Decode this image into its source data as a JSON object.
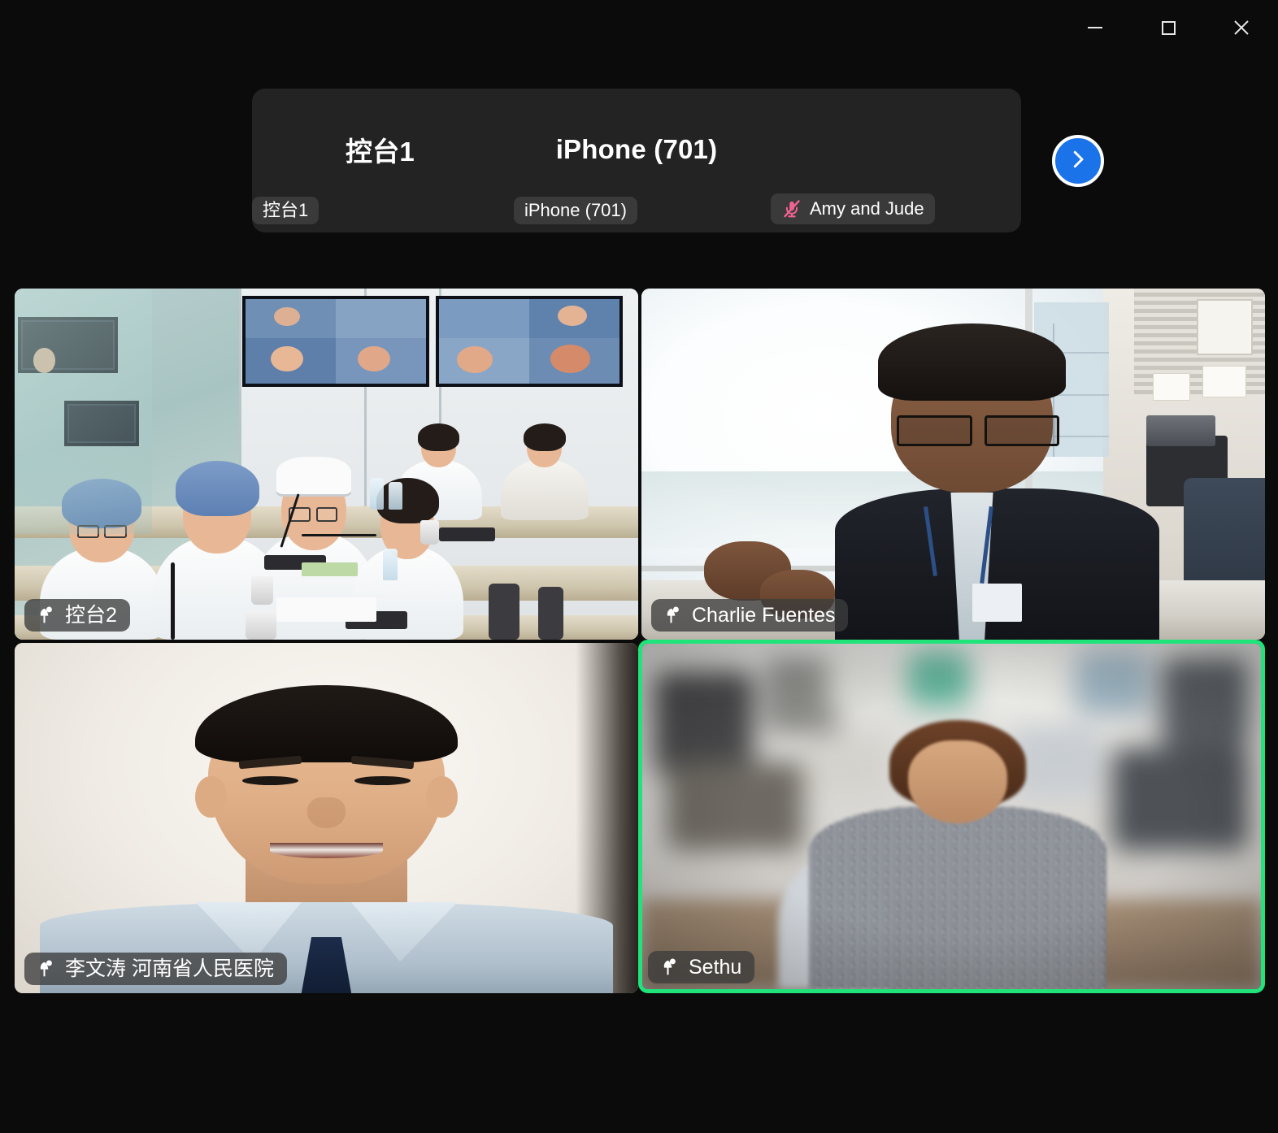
{
  "window": {
    "controls": [
      {
        "name": "minimize",
        "glyph": "minimize-icon"
      },
      {
        "name": "maximize",
        "glyph": "maximize-icon"
      },
      {
        "name": "close",
        "glyph": "close-icon"
      }
    ]
  },
  "filmstrip": {
    "tiles": [
      {
        "display_name": "控台1",
        "badge_label": "控台1",
        "muted": false,
        "video_on": false
      },
      {
        "display_name": "iPhone (701)",
        "badge_label": "iPhone (701)",
        "muted": false,
        "video_on": false
      },
      {
        "display_name": "",
        "badge_label": "Amy and Jude",
        "muted": true,
        "video_on": false
      }
    ],
    "next_button_label": "next-page-arrow"
  },
  "grid": {
    "tiles": [
      {
        "position": "top-left",
        "name_label": "控台2",
        "pinned": true,
        "active_speaker": false,
        "scene": "hospital conference room, staff in blue surgical caps and white coats at long tables, wall monitors showing remote video feeds"
      },
      {
        "position": "top-right",
        "name_label": "Charlie Fuentes",
        "pinned": true,
        "active_speaker": false,
        "scene": "man with glasses in dark suit seated beside a bright sunlit window overlooking a city"
      },
      {
        "position": "bottom-left",
        "name_label": "李文涛 河南省人民医院",
        "pinned": true,
        "active_speaker": false,
        "scene": "smiling man in light blue shirt and dark tie against a plain pale wall"
      },
      {
        "position": "bottom-right",
        "name_label": "Sethu",
        "pinned": true,
        "active_speaker": true,
        "scene": "blurred indoor room, woman in patterned blouse looking down"
      }
    ]
  },
  "colors": {
    "app_background": "#0b0b0b",
    "filmstrip_background": "#232323",
    "badge_background": "rgba(60,60,60,0.78)",
    "active_speaker_border": "#20e37a",
    "next_button_fill": "#1a73e8",
    "muted_mic": "#f06292",
    "text_primary": "#ffffff"
  }
}
